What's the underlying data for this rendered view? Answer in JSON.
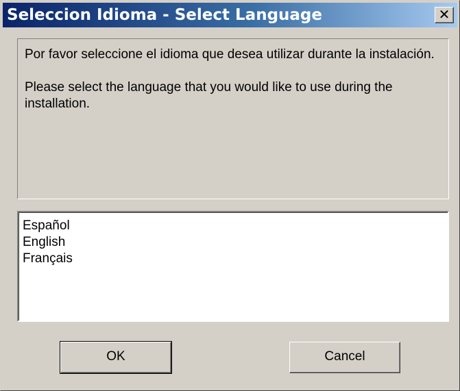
{
  "window": {
    "title": "Seleccion Idioma - Select Language",
    "close_glyph": "✕"
  },
  "message": {
    "spanish": "Por favor seleccione el idioma que desea utilizar durante la instalación.",
    "english": "Please select the language that you would like to use during the installation."
  },
  "languages": [
    "Español",
    "English",
    "Français"
  ],
  "buttons": {
    "ok": "OK",
    "cancel": "Cancel"
  },
  "colors": {
    "titlebar_start": "#0a246a",
    "titlebar_end": "#a6caf0",
    "face": "#d4d0c8"
  }
}
